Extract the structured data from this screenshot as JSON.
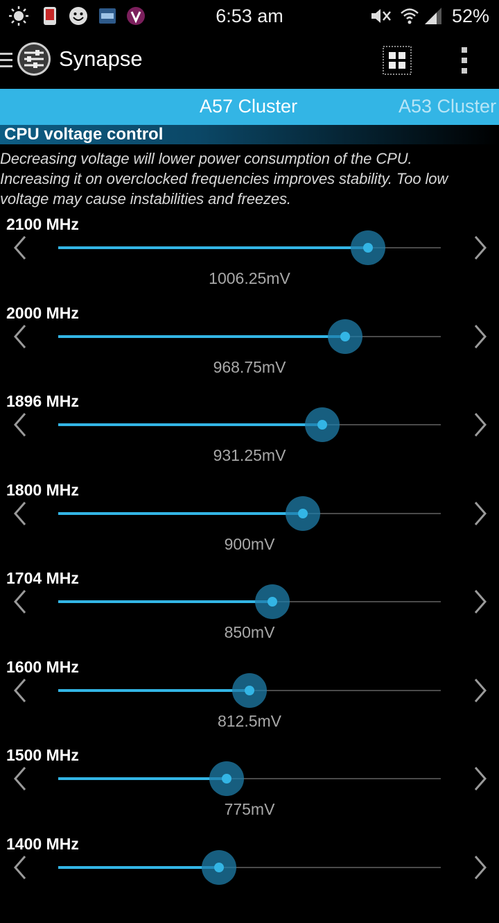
{
  "status_bar": {
    "time": "6:53 am",
    "battery": "52%",
    "icons": [
      "brightness-icon",
      "phone-icon",
      "smiley-icon",
      "pnl-app-icon",
      "v-app-icon",
      "mute-icon",
      "wifi-icon",
      "signal-icon"
    ]
  },
  "action_bar": {
    "title": "Synapse",
    "menu_icon": "hamburger-icon",
    "app_icon": "sliders-icon",
    "grid_icon": "grid-icon",
    "overflow_icon": "overflow-menu-icon"
  },
  "tabs": [
    {
      "label": "A57 Cluster",
      "active": true
    },
    {
      "label": "A53 Cluster",
      "active": false
    }
  ],
  "section": {
    "title": "CPU voltage control",
    "description_lines": [
      "Decreasing voltage will lower power consumption of the CPU.",
      "Increasing it on overclocked frequencies improves stability. Too low",
      "voltage may cause instabilities and freezes."
    ]
  },
  "colors": {
    "accent": "#33b5e5",
    "thumb_halo": "#1f7daa",
    "background": "#000000"
  },
  "slider_fraction_note_hidden": "",
  "rows": [
    {
      "freq": "2100 MHz",
      "value": "1006.25mV",
      "level": 0.81
    },
    {
      "freq": "2000 MHz",
      "value": "968.75mV",
      "level": 0.75
    },
    {
      "freq": "1896 MHz",
      "value": "931.25mV",
      "level": 0.69
    },
    {
      "freq": "1800 MHz",
      "value": "900mV",
      "level": 0.64
    },
    {
      "freq": "1704 MHz",
      "value": "850mV",
      "level": 0.56
    },
    {
      "freq": "1600 MHz",
      "value": "812.5mV",
      "level": 0.5
    },
    {
      "freq": "1500 MHz",
      "value": "775mV",
      "level": 0.44
    },
    {
      "freq": "1400 MHz",
      "value": "",
      "level": 0.42
    }
  ]
}
